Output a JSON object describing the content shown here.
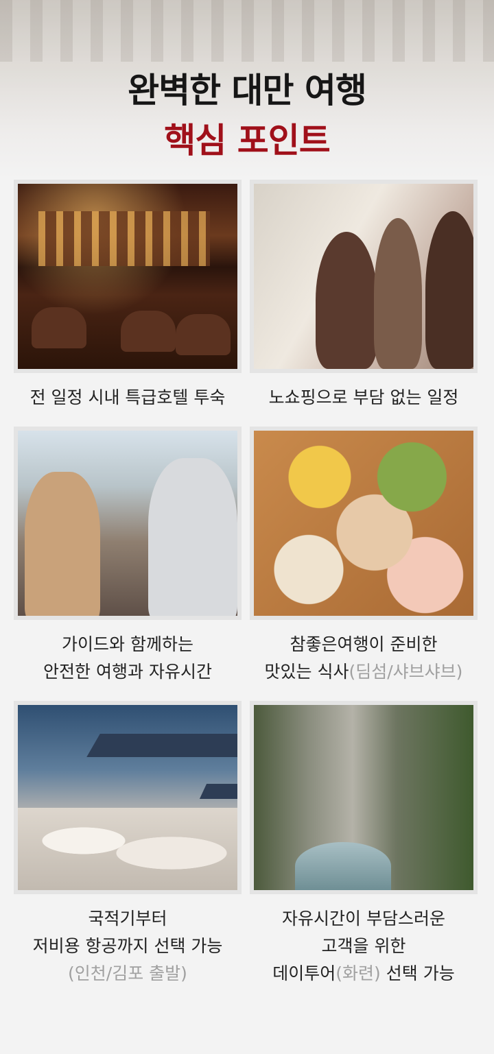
{
  "header": {
    "title_line1": "완벽한 대만 여행",
    "title_line2": "핵심 포인트"
  },
  "cards": [
    {
      "lines": [
        "전 일정 시내 특급호텔 투숙"
      ]
    },
    {
      "lines": [
        "노쇼핑으로 부담 없는 일정"
      ]
    },
    {
      "lines": [
        "가이드와 함께하는",
        "안전한 여행과 자유시간"
      ]
    },
    {
      "line1": "참좋은여행이 준비한",
      "line2_main": "맛있는 식사",
      "line2_muted": "(딤섬/샤브샤브)"
    },
    {
      "line1": "국적기부터",
      "line2": "저비용 항공까지 선택 가능",
      "line3_muted": "(인천/김포 출발)"
    },
    {
      "line1": "자유시간이 부담스러운",
      "line2": "고객을 위한",
      "line3_main1": "데이투어",
      "line3_muted": "(화련)",
      "line3_main2": " 선택 가능"
    }
  ],
  "colors": {
    "title_dark": "#161616",
    "title_accent": "#a0101a",
    "muted_text": "#a0a0a0"
  }
}
